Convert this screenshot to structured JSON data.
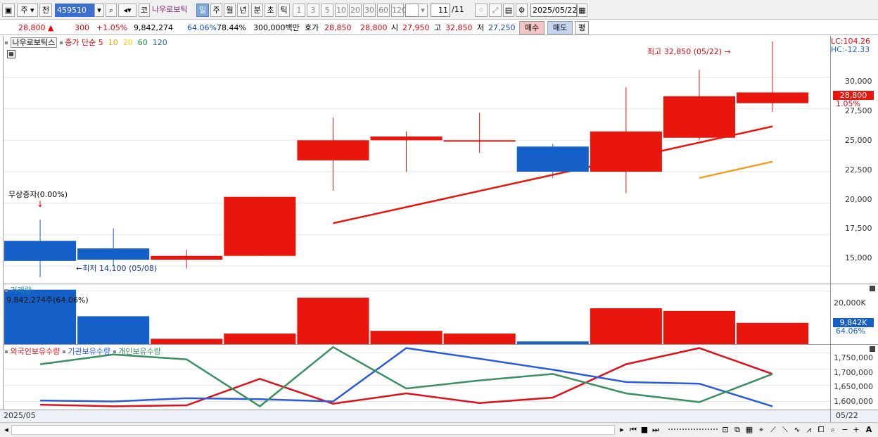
{
  "toolbar": {
    "mode_label": "주",
    "prev_label": "전",
    "code_value": "459510",
    "market_label": "코",
    "stock_name": "나우로보틱",
    "periods": [
      "일",
      "주",
      "월",
      "년",
      "분",
      "초",
      "틱"
    ],
    "selected_period": "일",
    "intervals": [
      "1",
      "3",
      "5",
      "10",
      "20",
      "30",
      "60",
      "120"
    ],
    "count": "11",
    "count_total": "/11",
    "date": "2025/05/22"
  },
  "quote": {
    "price": "28,800 ▲",
    "change": "300",
    "change_pct": "+1.05%",
    "volume": "9,842,274",
    "vol_pct": "64.06%",
    "turnover": "78.44%",
    "amount": "300,000백만",
    "bid_label": "호가",
    "bid": "28,850",
    "ask": "28,800",
    "open_label": "시",
    "open": "27,950",
    "high_label": "고",
    "high": "32,850",
    "low_label": "저",
    "low": "27,250",
    "buy_label": "매수",
    "sell_label": "매도",
    "flat_label": "평"
  },
  "price_panel": {
    "stock_tag": "나우로보틱스",
    "legend_label": "종가 단순",
    "ma_labels": [
      "5",
      "10",
      "20",
      "60",
      "120"
    ],
    "ma_colors": [
      "#e8000b",
      "#f0a000",
      "#f0d000",
      "#1e8c3c",
      "#1e64c8"
    ],
    "lc_label": "LC:104.26",
    "hc_label": "HC:-12.33",
    "y_ticks": [
      "30,000",
      "27,500",
      "25,000",
      "22,500",
      "20,000",
      "17,500",
      "15,000"
    ],
    "price_tag": "28,800",
    "price_pct": "1.05%",
    "max_note": "최고 32,850 (05/22)",
    "min_note": "최저 14,100 (05/08)",
    "event_note": "무상증자(0.00%)"
  },
  "volume_panel": {
    "title": "거래량",
    "info": "9,842,274주(64.06%)",
    "y_tick": "20,000K",
    "vol_tag": "9,842K",
    "vol_pct": "64.06%"
  },
  "holdings_panel": {
    "legend": [
      "외국인보유수량",
      "기관보유수량",
      "개인보유수량"
    ],
    "y_ticks": [
      "1,750,000",
      "1,700,000",
      "1,650,000",
      "1,600,000"
    ]
  },
  "footer": {
    "start_date": "2025/05",
    "end_date": "05/22"
  },
  "colors": {
    "up": "#e8160c",
    "down": "#1560c8",
    "foreign": "#e0101a",
    "inst": "#2a5ae0",
    "indiv": "#3a9060"
  },
  "chart_data": {
    "type": "candlestick",
    "candles": [
      {
        "o": 17000,
        "h": 18700,
        "l": 14100,
        "c": 15400,
        "up": false
      },
      {
        "o": 16400,
        "h": 18000,
        "l": 15000,
        "c": 15500,
        "up": false
      },
      {
        "o": 15500,
        "h": 16300,
        "l": 14800,
        "c": 15800,
        "up": true
      },
      {
        "o": 15800,
        "h": 20500,
        "l": 15800,
        "c": 20500,
        "up": true
      },
      {
        "o": 23400,
        "h": 26800,
        "l": 21000,
        "c": 25000,
        "up": true
      },
      {
        "o": 25000,
        "h": 25700,
        "l": 22500,
        "c": 25300,
        "up": true
      },
      {
        "o": 24900,
        "h": 27200,
        "l": 24000,
        "c": 25000,
        "up": true
      },
      {
        "o": 24500,
        "h": 24700,
        "l": 22000,
        "c": 22500,
        "up": false
      },
      {
        "o": 22500,
        "h": 29200,
        "l": 20800,
        "c": 25700,
        "up": true
      },
      {
        "o": 25200,
        "h": 30600,
        "l": 25000,
        "c": 28500,
        "up": true
      },
      {
        "o": 27950,
        "h": 32850,
        "l": 27250,
        "c": 28800,
        "up": true
      }
    ],
    "ma5": [
      null,
      null,
      null,
      null,
      18400,
      null,
      null,
      null,
      null,
      null,
      26100
    ],
    "ma10": [
      null,
      null,
      null,
      null,
      null,
      null,
      null,
      null,
      null,
      22000,
      23300
    ],
    "volume": [
      20500,
      10500,
      2000,
      4000,
      17500,
      5000,
      4000,
      1000,
      13500,
      12500,
      8000
    ],
    "foreign": [
      1590000,
      1585000,
      1588000,
      1670000,
      1593000,
      1625000,
      1595000,
      1612000,
      1715000,
      1765000,
      1685000
    ],
    "inst": [
      1603000,
      1600000,
      1610000,
      1607000,
      1600000,
      1765000,
      1732000,
      1698000,
      1660000,
      1655000,
      1585000
    ],
    "indiv": [
      1715000,
      1745000,
      1730000,
      1585000,
      1768000,
      1640000,
      1665000,
      1685000,
      1625000,
      1598000,
      1685000
    ],
    "ylim_price": [
      13600,
      33300
    ],
    "ylim_volume": [
      0,
      22000
    ],
    "ylim_holdings": [
      1575000,
      1775000
    ]
  }
}
